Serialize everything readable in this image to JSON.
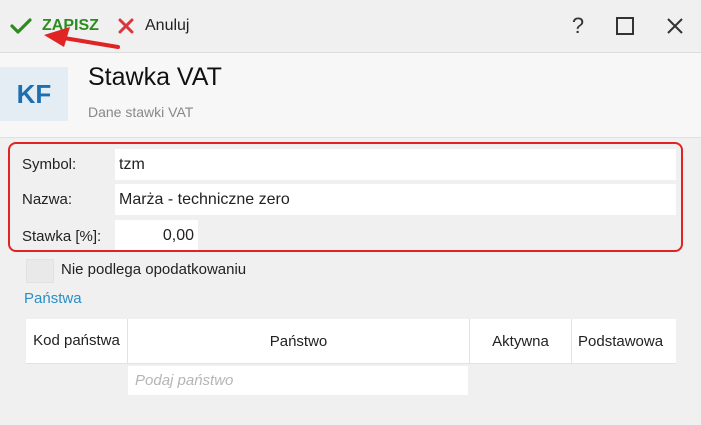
{
  "toolbar": {
    "save_label": "ZAPISZ",
    "save_icon": "checkmark-icon",
    "cancel_label": "Anuluj",
    "cancel_icon": "x-icon",
    "help_label": "?",
    "window_icons": [
      "help-icon",
      "maximize-icon",
      "close-icon"
    ]
  },
  "header": {
    "logo": "KF",
    "title": "Stawka VAT",
    "subtitle": "Dane stawki VAT"
  },
  "form": {
    "symbol": {
      "label": "Symbol:",
      "value": "tzm"
    },
    "nazwa": {
      "label": "Nazwa:",
      "value": "Marża - techniczne zero"
    },
    "stawka": {
      "label": "Stawka [%]:",
      "value": "0,00"
    },
    "not_taxable": {
      "label": "Nie podlega opodatkowaniu",
      "checked": false
    }
  },
  "countries": {
    "section_title": "Państwa",
    "columns": [
      "Kod państwa",
      "Państwo",
      "Aktywna",
      "Podstawowa"
    ],
    "new_row_placeholder": "Podaj państwo",
    "rows": []
  },
  "colors": {
    "save_green": "#2e8b1f",
    "cancel_red": "#d9363e",
    "highlight_red": "#e02424",
    "link_blue": "#2a8fc7",
    "logo_blue": "#1d6fb2"
  }
}
